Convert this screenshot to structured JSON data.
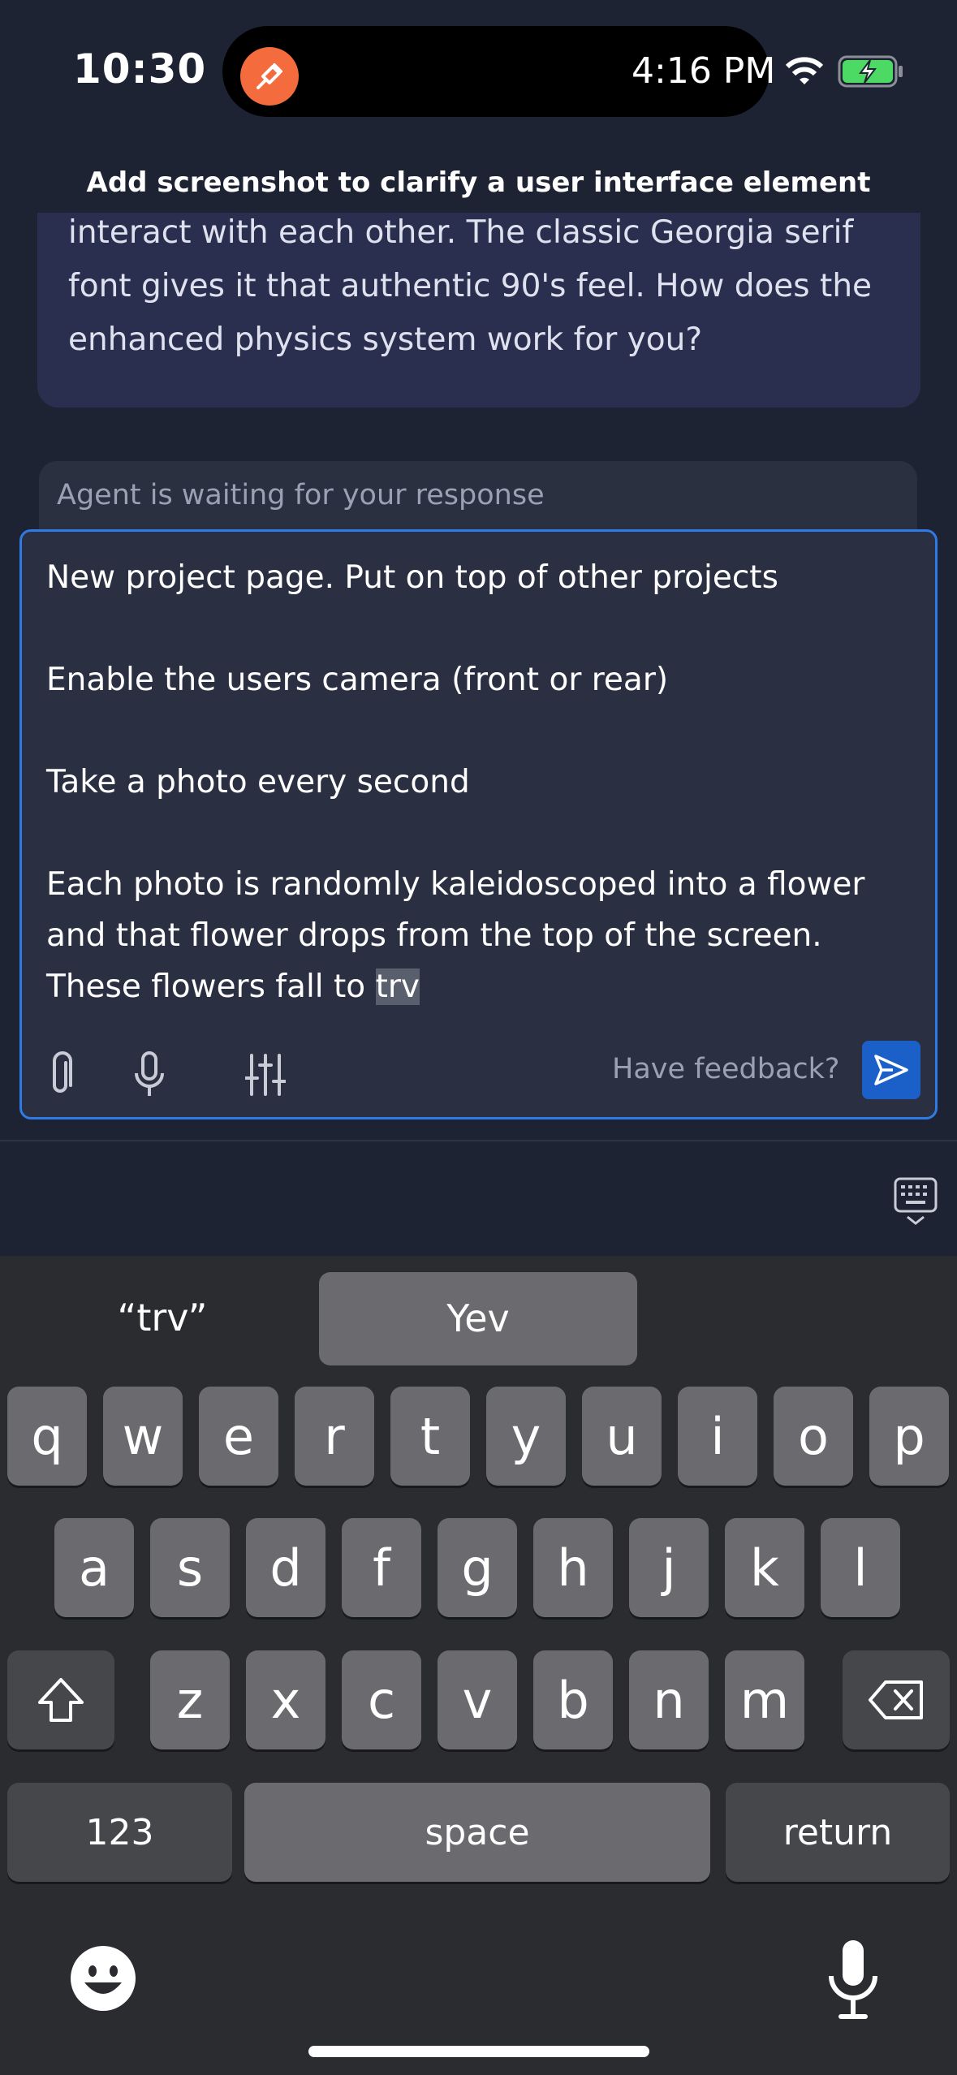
{
  "status_bar": {
    "time": "10:30",
    "island_time": "4:16 PM"
  },
  "banner": "Add screenshot to clarify a user interface element",
  "message": {
    "text": "interact with each other. The classic Georgia serif font gives it that authentic 90's feel. How does the enhanced physics system work for you?"
  },
  "waiting": "Agent is waiting for your response",
  "input": {
    "text_before": "New project page. Put on top of other projects\n\nEnable the users camera (front or rear)\n\nTake a photo every second\n\nEach photo is randomly kaleidoscoped into a flower and that flower drops from the top of the screen. These flowers fall to ",
    "selected": "trv"
  },
  "toolbar": {
    "feedback": "Have feedback?"
  },
  "keyboard": {
    "suggestion_left": "“trv”",
    "suggestion_mid": "Yev",
    "row1": [
      "q",
      "w",
      "e",
      "r",
      "t",
      "y",
      "u",
      "i",
      "o",
      "p"
    ],
    "row2": [
      "a",
      "s",
      "d",
      "f",
      "g",
      "h",
      "j",
      "k",
      "l"
    ],
    "row3": [
      "z",
      "x",
      "c",
      "v",
      "b",
      "n",
      "m"
    ],
    "numbers": "123",
    "space": "space",
    "return": "return"
  },
  "colors": {
    "accent": "#2f7ae5",
    "send": "#1b60c9",
    "record": "#f46c3e",
    "battery": "#4cd964"
  }
}
